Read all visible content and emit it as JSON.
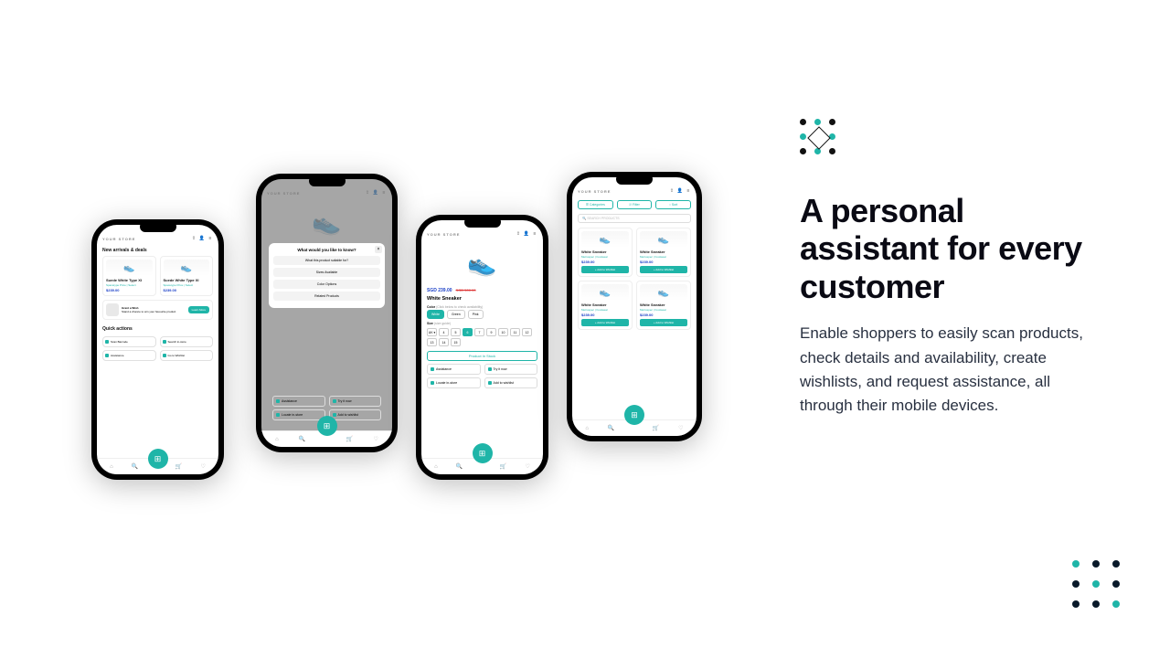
{
  "app_title": "YOUR STORE",
  "app_title_alt": "YOUR STORE",
  "new_arrivals_heading": "New arrivals & deals",
  "product_sample": {
    "name": "Suede White Type XI",
    "meta": "Spacetype Price | Select",
    "price": "$239.00"
  },
  "wish": {
    "title": "Grant a Wish",
    "sub": "Stand a chance to win your favourite product",
    "cta": "Learn More"
  },
  "quick_actions_heading": "Quick actions",
  "qa": [
    "Scan Barcode",
    "Search in-store",
    "Assistance",
    "Go to Wishlist"
  ],
  "modal": {
    "title": "What would you like to know?",
    "opts": [
      "What this product suitable for?",
      "Sizes Available",
      "Color Options",
      "Related Products"
    ]
  },
  "below_modal": [
    "Assistance",
    "Try it now",
    "Locate in-store",
    "Add to wishlist"
  ],
  "pdp": {
    "price": "SGD 239.00",
    "old": "SGD 500.00",
    "title": "White Sneaker",
    "color_label": "Color",
    "color_hint": "(Click below to check availability)",
    "colors": [
      "White",
      "Green",
      "Pink"
    ],
    "size_label": "Size",
    "size_hint": "(size guide)",
    "sizes": [
      "4",
      "5",
      "6",
      "7",
      "9",
      "10",
      "11",
      "12",
      "13",
      "14",
      "15"
    ],
    "stock": "Product In Stock",
    "actions": [
      "Assistance",
      "Try it now",
      "Locate in-store",
      "Add to wishlist"
    ]
  },
  "listing": {
    "filters": [
      "☰ Categories",
      "⎚ Filter",
      "↕ Sort"
    ],
    "search_ph": "SEARCH PRODUCTS",
    "card": {
      "name": "White Sneaker",
      "meta": "Metrospec | Footwear",
      "price": "$239.00",
      "cta": "+ Add to Wishlist"
    }
  },
  "copy": {
    "heading": "A personal assistant for every customer",
    "body": "Enable shoppers to easily scan products, check details and availability, create wishlists, and request assistance, all through their mobile devices."
  }
}
